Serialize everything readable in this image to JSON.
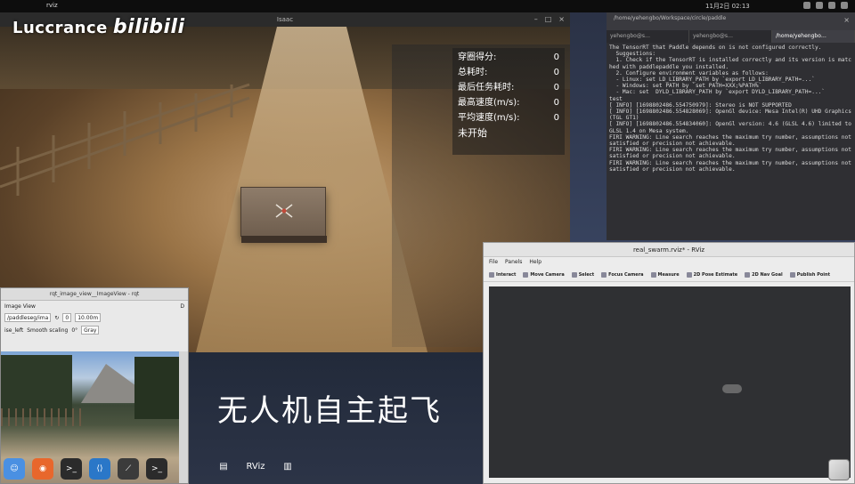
{
  "topbar": {
    "app_title": "rviz",
    "clock": "11月2日 02:13"
  },
  "watermark": {
    "name": "Luccrance",
    "brand": "bilibili"
  },
  "sim_window": {
    "title": "Isaac",
    "hud": {
      "rows": [
        {
          "label": "穿圈得分:",
          "value": "0"
        },
        {
          "label": "总耗时:",
          "value": "0"
        },
        {
          "label": "最后任务耗时:",
          "value": "0"
        },
        {
          "label": "最高速度(m/s):",
          "value": "0"
        },
        {
          "label": "平均速度(m/s):",
          "value": "0"
        }
      ],
      "status": "未开始"
    }
  },
  "terminal": {
    "title": "/home/yehengbo/Workspace/circle/paddle",
    "tabs": [
      "yehengbo@s…",
      "yehengbo@s…",
      "/home/yehengbo…"
    ],
    "lines": [
      "The TensorRT that Paddle depends on is not configured correctly.",
      "  Suggestions:",
      "  1. Check if the TensorRT is installed correctly and its version is matched with paddlepaddle you installed.",
      "  2. Configure environment variables as follows:",
      "  - Linux: set LD_LIBRARY_PATH by `export LD_LIBRARY_PATH=...`",
      "  - Windows: set PATH by `set PATH=XXX;%PATH%`",
      "  - Mac: set  DYLD_LIBRARY_PATH by `export DYLD_LIBRARY_PATH=...`",
      "test",
      "[ INFO] [1698802486.554750979]: Stereo is NOT SUPPORTED",
      "[ INFO] [1698802486.554828069]: OpenGl device: Mesa Intel(R) UHD Graphics (TGL GT1)",
      "[ INFO] [1698802486.554834060]: OpenGl version: 4.6 (GLSL 4.6) limited to GLSL 1.4 on Mesa system.",
      "FIRI WARNING: Line search reaches the maximum try number, assumptions not satisfied or precision not achievable.",
      "FIRI WARNING: Line search reaches the maximum try number, assumptions not satisfied or precision not achievable.",
      "FIRI WARNING: Line search reaches the maximum try number, assumptions not satisfied or precision not achievable."
    ]
  },
  "rqt": {
    "title": "rqt_image_view__ImageView - rqt",
    "plugin": "Image View",
    "plugin_badge": "D",
    "topic": "/paddleseg/ima",
    "value1": "0",
    "value2": "10.00m",
    "label_left": "ise_left",
    "smooth": "Smooth scaling",
    "rotation": "0°",
    "color": "Gray"
  },
  "subtitle": "无人机自主起飞",
  "rviz": {
    "title": "real_swarm.rviz* - RViz",
    "menu": [
      "File",
      "Panels",
      "Help"
    ],
    "tools": [
      "Interact",
      "Move Camera",
      "Select",
      "Focus Camera",
      "Measure",
      "2D Pose Estimate",
      "2D Nav Goal",
      "Publish Point"
    ]
  },
  "dock": {
    "items": [
      {
        "name": "finder",
        "color": "#4a90e2",
        "glyph": "☺"
      },
      {
        "name": "firefox",
        "color": "#e8672c",
        "glyph": "◉"
      },
      {
        "name": "terminal",
        "color": "#2b2b2b",
        "glyph": ">_"
      },
      {
        "name": "vscode",
        "color": "#2a77c8",
        "glyph": "⟨⟩"
      },
      {
        "name": "rviz",
        "color": "#3b3b3b",
        "glyph": "⟋"
      },
      {
        "name": "terminal",
        "color": "#2b2b2b",
        "glyph": ">_"
      }
    ],
    "tray": [
      {
        "name": "file",
        "glyph": "▤"
      },
      {
        "name": "rviz",
        "glyph": "RViz"
      },
      {
        "name": "trash",
        "glyph": "▥"
      }
    ]
  }
}
